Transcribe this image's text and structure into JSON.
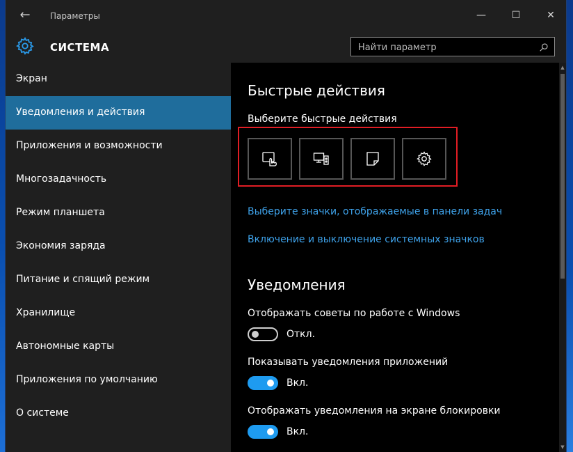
{
  "window": {
    "title": "Параметры",
    "back_glyph": "←",
    "minimize_glyph": "—",
    "maximize_glyph": "☐",
    "close_glyph": "✕"
  },
  "header": {
    "section_title": "СИСТЕМА",
    "search_placeholder": "Найти параметр",
    "logo_icon": "gear-icon",
    "search_icon": "search-icon"
  },
  "sidebar": {
    "items": [
      {
        "label": "Экран",
        "active": false
      },
      {
        "label": "Уведомления и действия",
        "active": true
      },
      {
        "label": "Приложения и возможности",
        "active": false
      },
      {
        "label": "Многозадачность",
        "active": false
      },
      {
        "label": "Режим планшета",
        "active": false
      },
      {
        "label": "Экономия заряда",
        "active": false
      },
      {
        "label": "Питание и спящий режим",
        "active": false
      },
      {
        "label": "Хранилище",
        "active": false
      },
      {
        "label": "Автономные карты",
        "active": false
      },
      {
        "label": "Приложения по умолчанию",
        "active": false
      },
      {
        "label": "О системе",
        "active": false
      }
    ]
  },
  "content": {
    "quick_actions": {
      "heading": "Быстрые действия",
      "subheading": "Выберите быстрые действия",
      "tiles": [
        {
          "icon": "tablet-mode-icon"
        },
        {
          "icon": "connect-icon"
        },
        {
          "icon": "note-icon"
        },
        {
          "icon": "settings-icon"
        }
      ],
      "link_taskbar_icons": "Выберите значки, отображаемые в панели задач",
      "link_system_icons": "Включение и выключение системных значков"
    },
    "notifications": {
      "heading": "Уведомления",
      "settings": [
        {
          "label": "Отображать советы по работе с Windows",
          "state_label": "Откл.",
          "on": false
        },
        {
          "label": "Показывать уведомления приложений",
          "state_label": "Вкл.",
          "on": true
        },
        {
          "label": "Отображать уведомления на экране блокировки",
          "state_label": "Вкл.",
          "on": true
        }
      ]
    }
  },
  "colors": {
    "accent": "#1e9bf0",
    "link": "#3ea2ea",
    "active_nav": "#1f6d9c",
    "highlight_box": "#e11d24"
  }
}
